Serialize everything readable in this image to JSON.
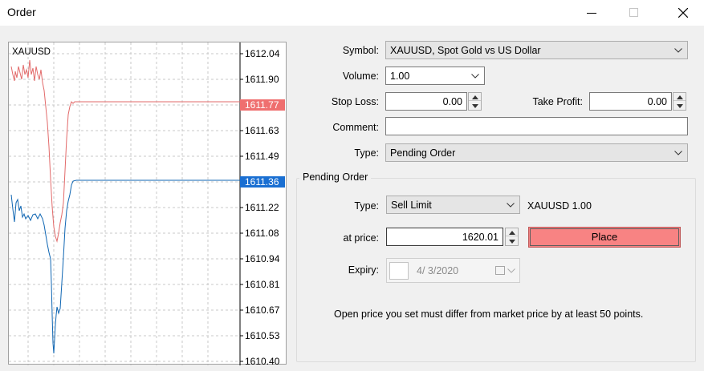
{
  "window": {
    "title": "Order"
  },
  "chart": {
    "symbol_label": "XAUUSD",
    "price_ticks": [
      "1612.04",
      "1611.90",
      "1611.77",
      "1611.63",
      "1611.49",
      "1611.36",
      "1611.22",
      "1611.08",
      "1610.94",
      "1610.81",
      "1610.67",
      "1610.53",
      "1610.40"
    ],
    "ask_price": "1611.77",
    "bid_price": "1611.36",
    "colors": {
      "ask": "#e26a6a",
      "bid": "#0f66b3",
      "ask_tag": "#ef6f6f",
      "bid_tag": "#1a6fd2",
      "grid": "#c8c8c8"
    }
  },
  "form": {
    "symbol_label": "Symbol:",
    "symbol_value": "XAUUSD, Spot Gold vs US Dollar",
    "volume_label": "Volume:",
    "volume_value": "1.00",
    "stoploss_label": "Stop Loss:",
    "stoploss_value": "0.00",
    "takeprofit_label": "Take Profit:",
    "takeprofit_value": "0.00",
    "comment_label": "Comment:",
    "comment_value": "",
    "type_label": "Type:",
    "type_value": "Pending Order"
  },
  "pending": {
    "group_title": "Pending Order",
    "type_label": "Type:",
    "type_value": "Sell Limit",
    "summary": "XAUUSD 1.00",
    "price_label": "at price:",
    "price_value": "1620.01",
    "place_label": "Place",
    "place_color": "#f88383",
    "expiry_label": "Expiry:",
    "expiry_value": "4/  3/2020",
    "note": "Open price you set must differ from market price by at least 50 points."
  }
}
